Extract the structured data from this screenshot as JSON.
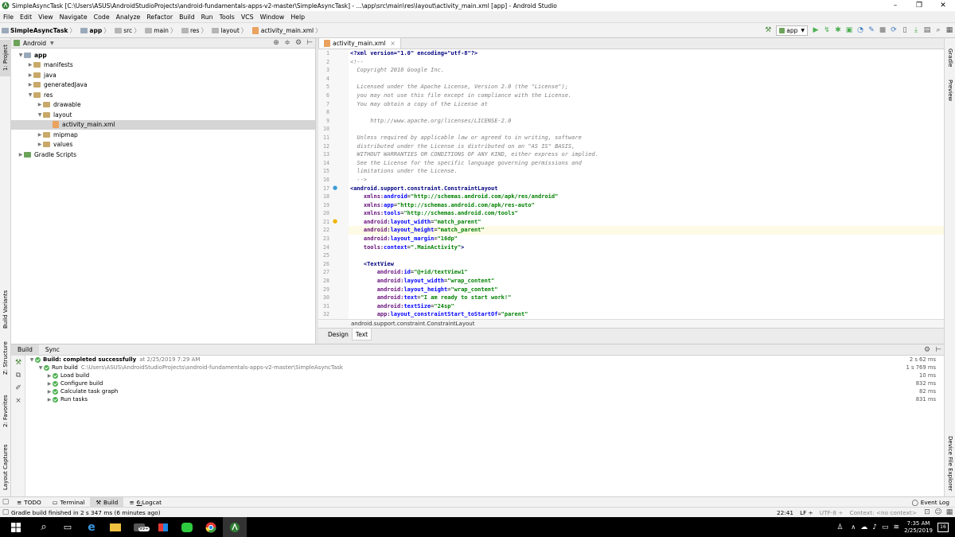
{
  "window": {
    "title": "SimpleAsyncTask [C:\\Users\\ASUS\\AndroidStudioProjects\\android-fundamentals-apps-v2-master\\SimpleAsyncTask] - ...\\app\\src\\main\\res\\layout\\activity_main.xml [app] - Android Studio",
    "minimize": "–",
    "maximize": "❐",
    "close": "✕"
  },
  "menu": [
    "File",
    "Edit",
    "View",
    "Navigate",
    "Code",
    "Analyze",
    "Refactor",
    "Build",
    "Run",
    "Tools",
    "VCS",
    "Window",
    "Help"
  ],
  "breadcrumb": [
    "SimpleAsyncTask",
    "app",
    "src",
    "main",
    "res",
    "layout",
    "activity_main.xml"
  ],
  "toolbar": {
    "run_config": "app"
  },
  "left_tools": {
    "project": "1: Project",
    "build_variants": "Build Variants",
    "structure": "Z: Structure",
    "favorites": "2: Favorites",
    "layout_captures": "Layout Captures"
  },
  "right_tools": {
    "gradle": "Gradle",
    "preview": "Preview",
    "device_explorer": "Device File Explorer"
  },
  "project": {
    "view_mode": "Android",
    "tree": [
      {
        "label": "app",
        "depth": 0,
        "arrow": "▼",
        "icon": "folder-blue"
      },
      {
        "label": "manifests",
        "depth": 1,
        "arrow": "▶",
        "icon": "folder"
      },
      {
        "label": "java",
        "depth": 1,
        "arrow": "▶",
        "icon": "folder"
      },
      {
        "label": "generatedJava",
        "depth": 1,
        "arrow": "▶",
        "icon": "folder"
      },
      {
        "label": "res",
        "depth": 1,
        "arrow": "▼",
        "icon": "folder"
      },
      {
        "label": "drawable",
        "depth": 2,
        "arrow": "▶",
        "icon": "folder"
      },
      {
        "label": "layout",
        "depth": 2,
        "arrow": "▼",
        "icon": "folder"
      },
      {
        "label": "activity_main.xml",
        "depth": 3,
        "arrow": "",
        "icon": "xml"
      },
      {
        "label": "mipmap",
        "depth": 2,
        "arrow": "▶",
        "icon": "folder"
      },
      {
        "label": "values",
        "depth": 2,
        "arrow": "▶",
        "icon": "folder"
      },
      {
        "label": "Gradle Scripts",
        "depth": 0,
        "arrow": "▶",
        "icon": "gradle"
      }
    ]
  },
  "editor": {
    "tab": "activity_main.xml",
    "line_numbers": [
      "1",
      "2",
      "3",
      "4",
      "5",
      "6",
      "7",
      "8",
      "9",
      "10",
      "11",
      "12",
      "13",
      "14",
      "15",
      "16",
      "17",
      "18",
      "19",
      "20",
      "21",
      "22",
      "23",
      "24",
      "25",
      "26",
      "27",
      "28",
      "29",
      "30",
      "31",
      "32"
    ],
    "lines": [
      [
        [
          "pi",
          "<?xml version=\"1.0\" encoding=\"utf-8\"?>"
        ]
      ],
      [
        [
          "cmt",
          "<!--"
        ]
      ],
      [
        [
          "cmt",
          "  Copyright 2018 Google Inc."
        ]
      ],
      [
        [
          "cmt",
          ""
        ]
      ],
      [
        [
          "cmt",
          "  Licensed under the Apache License, Version 2.0 (the \"License\");"
        ]
      ],
      [
        [
          "cmt",
          "  you may not use this file except in compliance with the License."
        ]
      ],
      [
        [
          "cmt",
          "  You may obtain a copy of the License at"
        ]
      ],
      [
        [
          "cmt",
          ""
        ]
      ],
      [
        [
          "cmt",
          "      http://www.apache.org/licenses/LICENSE-2.0"
        ]
      ],
      [
        [
          "cmt",
          ""
        ]
      ],
      [
        [
          "cmt",
          "  Unless required by applicable law or agreed to in writing, software"
        ]
      ],
      [
        [
          "cmt",
          "  distributed under the License is distributed on an \"AS IS\" BASIS,"
        ]
      ],
      [
        [
          "cmt",
          "  WITHOUT WARRANTIES OR CONDITIONS OF ANY KIND, either express or implied."
        ]
      ],
      [
        [
          "cmt",
          "  See the License for the specific language governing permissions and"
        ]
      ],
      [
        [
          "cmt",
          "  limitations under the License."
        ]
      ],
      [
        [
          "cmt",
          "  -->"
        ]
      ],
      [
        [
          "tag",
          "<android.support.constraint.ConstraintLayout"
        ]
      ],
      [
        [
          "",
          "    "
        ],
        [
          "ns",
          "xmlns:"
        ],
        [
          "attr",
          "android"
        ],
        [
          "",
          "="
        ],
        [
          "val",
          "\"http://schemas.android.com/apk/res/android\""
        ]
      ],
      [
        [
          "",
          "    "
        ],
        [
          "ns",
          "xmlns:"
        ],
        [
          "attr",
          "app"
        ],
        [
          "",
          "="
        ],
        [
          "val",
          "\"http://schemas.android.com/apk/res-auto\""
        ]
      ],
      [
        [
          "",
          "    "
        ],
        [
          "ns",
          "xmlns:"
        ],
        [
          "attr",
          "tools"
        ],
        [
          "",
          "="
        ],
        [
          "val",
          "\"http://schemas.android.com/tools\""
        ]
      ],
      [
        [
          "",
          "    "
        ],
        [
          "ns",
          "android:"
        ],
        [
          "attr",
          "layout_width"
        ],
        [
          "",
          "="
        ],
        [
          "val",
          "\"match_parent\""
        ]
      ],
      [
        [
          "",
          "    "
        ],
        [
          "ns",
          "android:"
        ],
        [
          "attr",
          "layout_height"
        ],
        [
          "",
          "="
        ],
        [
          "val",
          "\"match_parent\""
        ]
      ],
      [
        [
          "",
          "    "
        ],
        [
          "ns",
          "android:"
        ],
        [
          "attr",
          "layout_margin"
        ],
        [
          "",
          "="
        ],
        [
          "val",
          "\"16dp\""
        ]
      ],
      [
        [
          "",
          "    "
        ],
        [
          "ns",
          "tools:"
        ],
        [
          "attr",
          "context"
        ],
        [
          "",
          "="
        ],
        [
          "val",
          "\".MainActivity\""
        ],
        [
          "tag",
          ">"
        ]
      ],
      [
        [
          "",
          ""
        ]
      ],
      [
        [
          "",
          "    "
        ],
        [
          "tag",
          "<TextView"
        ]
      ],
      [
        [
          "",
          "        "
        ],
        [
          "ns",
          "android:"
        ],
        [
          "attr",
          "id"
        ],
        [
          "",
          "="
        ],
        [
          "val",
          "\"@+id/textView1\""
        ]
      ],
      [
        [
          "",
          "        "
        ],
        [
          "ns",
          "android:"
        ],
        [
          "attr",
          "layout_width"
        ],
        [
          "",
          "="
        ],
        [
          "val",
          "\"wrap_content\""
        ]
      ],
      [
        [
          "",
          "        "
        ],
        [
          "ns",
          "android:"
        ],
        [
          "attr",
          "layout_height"
        ],
        [
          "",
          "="
        ],
        [
          "val",
          "\"wrap_content\""
        ]
      ],
      [
        [
          "",
          "        "
        ],
        [
          "ns",
          "android:"
        ],
        [
          "attr",
          "text"
        ],
        [
          "",
          "="
        ],
        [
          "val",
          "\"I am ready to start work!\""
        ]
      ],
      [
        [
          "",
          "        "
        ],
        [
          "ns",
          "android:"
        ],
        [
          "attr",
          "textSize"
        ],
        [
          "",
          "="
        ],
        [
          "val",
          "\"24sp\""
        ]
      ],
      [
        [
          "",
          "        "
        ],
        [
          "ns",
          "app:"
        ],
        [
          "attr",
          "layout_constraintStart_toStartOf"
        ],
        [
          "",
          "="
        ],
        [
          "val",
          "\"parent\""
        ]
      ]
    ],
    "highlight_line": 22,
    "breadcrumb": "android.support.constraint.ConstraintLayout",
    "mode_tabs": [
      "Design",
      "Text"
    ],
    "active_mode": "Text"
  },
  "build": {
    "tabs": [
      "Build",
      "Sync"
    ],
    "rows": [
      {
        "label": "Build: completed successfully",
        "extra": "at 2/25/2019 7:29 AM",
        "duration": "2 s 62 ms",
        "depth": 0,
        "arrow": "▼",
        "bold": true
      },
      {
        "label": "Run build",
        "extra": "C:\\Users\\ASUS\\AndroidStudioProjects\\android-fundamentals-apps-v2-master\\SimpleAsyncTask",
        "duration": "1 s 769 ms",
        "depth": 1,
        "arrow": "▼",
        "bold": false
      },
      {
        "label": "Load build",
        "extra": "",
        "duration": "10 ms",
        "depth": 2,
        "arrow": "▶",
        "bold": false
      },
      {
        "label": "Configure build",
        "extra": "",
        "duration": "832 ms",
        "depth": 2,
        "arrow": "▶",
        "bold": false
      },
      {
        "label": "Calculate task graph",
        "extra": "",
        "duration": "82 ms",
        "depth": 2,
        "arrow": "▶",
        "bold": false
      },
      {
        "label": "Run tasks",
        "extra": "",
        "duration": "831 ms",
        "depth": 2,
        "arrow": "▶",
        "bold": false
      }
    ]
  },
  "bottom_tabs": [
    {
      "label": "TODO",
      "key": "",
      "icon": "≡"
    },
    {
      "label": "Terminal",
      "key": "",
      "icon": "▭"
    },
    {
      "label": "Build",
      "key": "",
      "icon": "⚒"
    },
    {
      "label": "Logcat",
      "key": "6: ",
      "icon": "≡"
    }
  ],
  "event_log": "Event Log",
  "status": {
    "message": "Gradle build finished in 2 s 347 ms (6 minutes ago)",
    "position": "22:41",
    "line_sep": "LF ÷",
    "encoding": "UTF-8 ÷",
    "context": "Context: <no context>"
  },
  "taskbar": {
    "time": "7:35 AM",
    "date": "2/25/2019",
    "badge": "99+",
    "notif": "16"
  },
  "colors": {
    "accent_green": "#4caf50",
    "tag": "#000080",
    "string": "#008000",
    "comment": "#808080"
  }
}
